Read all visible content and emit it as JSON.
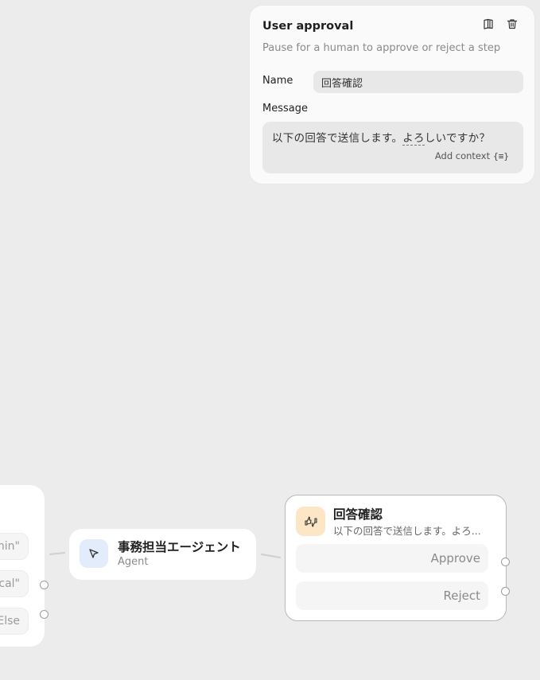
{
  "panel": {
    "title": "User approval",
    "description": "Pause for a human to approve or reject a step",
    "icons": [
      "book-icon",
      "trash-icon"
    ],
    "name_label": "Name",
    "name_value": "回答確認",
    "message_label": "Message",
    "message_prefix": "以下の回答で送信します。",
    "message_underlined": "よろ",
    "message_suffix": "しいですか？",
    "add_context_label": "Add context",
    "add_context_icon": "{≡}"
  },
  "canvas": {
    "condition_node": {
      "conditions": [
        "min\"",
        "cal\"",
        "Else"
      ]
    },
    "agent_node": {
      "title": "事務担当エージェント",
      "subtitle": "Agent",
      "icon": "cursor-icon",
      "icon_bg": "#e3ecfb"
    },
    "approval_node": {
      "title": "回答確認",
      "subtitle": "以下の回答で送信します。よろ...",
      "icon": "thumbs-up-down-icon",
      "icon_bg": "#fde6c6",
      "branches": [
        "Approve",
        "Reject"
      ]
    }
  },
  "colors": {
    "canvas_bg": "#ececec",
    "node_bg": "#ffffff",
    "selected_border": "#b8b8b8"
  }
}
